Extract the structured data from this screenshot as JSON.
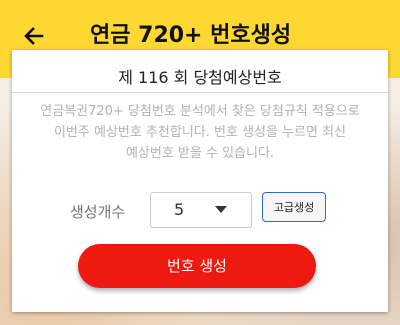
{
  "app_bar": {
    "back_icon": "back-arrow-icon",
    "title": "연금 720+ 번호생성",
    "background_color": "#fed832"
  },
  "card": {
    "title": "제 116 회 당첨예상번호",
    "description_lines": [
      "연금복권720+ 당첨번호 분석에서 찾은 당첨규칙 적용으로",
      "이번주 예상번호 추천합니다. 번호 생성을 누르면 최신",
      "예상번호 받을 수 있습니다."
    ],
    "count_label": "생성개수",
    "count_value": "5",
    "count_dropdown_icon": "dropdown-triangle-icon",
    "advanced_button_label": "고급생성",
    "generate_button_label": "번호 생성",
    "generate_button_color": "#ee1a12"
  }
}
